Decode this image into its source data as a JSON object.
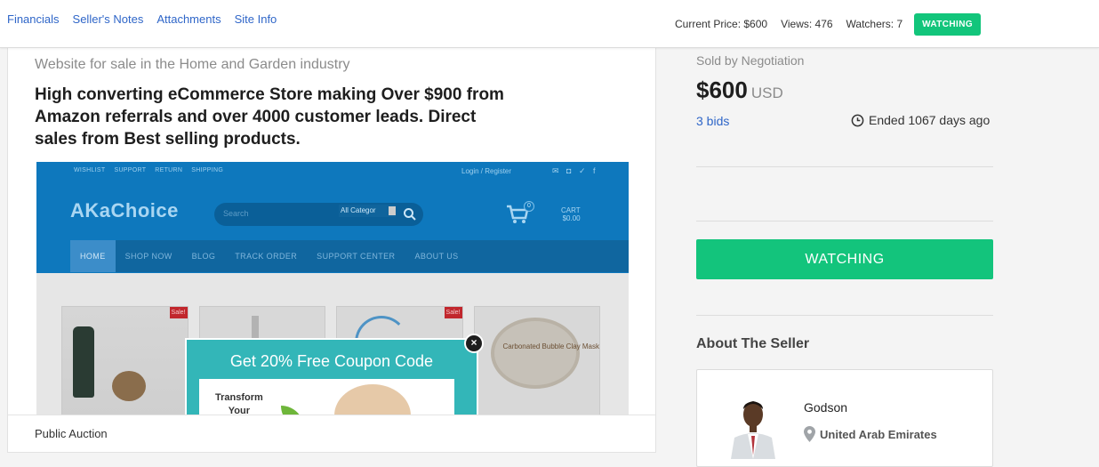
{
  "nav": {
    "tabs": [
      "Financials",
      "Seller's Notes",
      "Attachments",
      "Site Info"
    ],
    "current_price": "Current Price: $600",
    "views": "Views: 476",
    "watchers": "Watchers: 7",
    "watch_pill": "WATCHING"
  },
  "listing": {
    "industry_line": "Website for sale in the Home and Garden industry",
    "headline": "High converting eCommerce Store making Over $900 from Amazon referrals and over 4000 customer leads. Direct sales from Best selling products.",
    "footer_label": "Public Auction"
  },
  "preview": {
    "util_links": [
      "WISHLIST",
      "SUPPORT",
      "RETURN",
      "SHIPPING"
    ],
    "login": "Login / Register",
    "logo": "AKaChoice",
    "search_placeholder": "Search",
    "category": "All Categor",
    "cart_count": "0",
    "cart_label": "CART",
    "cart_total": "$0.00",
    "menu": [
      "HOME",
      "SHOP NOW",
      "BLOG",
      "TRACK ORDER",
      "SUPPORT CENTER",
      "ABOUT US"
    ],
    "sale_badge": "Sale!",
    "popup_title": "Get 20% Free Coupon Code",
    "popup_text_1": "Transform",
    "popup_text_2": "Your",
    "jar_label": "Carbonated Bubble Clay Mask",
    "close_glyph": "×"
  },
  "sidebar": {
    "sold_by": "Sold by Negotiation",
    "price": "$600",
    "currency": "USD",
    "bids": "3 bids",
    "ended": "Ended 1067 days ago",
    "watch_button": "WATCHING",
    "about_heading": "About The Seller",
    "seller_name": "Godson",
    "seller_location": "United Arab Emirates"
  },
  "colors": {
    "accent_green": "#13c47c",
    "link_blue": "#2f66c8",
    "preview_blue": "#0e78bd"
  },
  "icons": {
    "ended": "clock-icon",
    "location": "map-pin-icon",
    "cart": "cart-icon",
    "search": "search-icon",
    "close": "close-icon"
  }
}
